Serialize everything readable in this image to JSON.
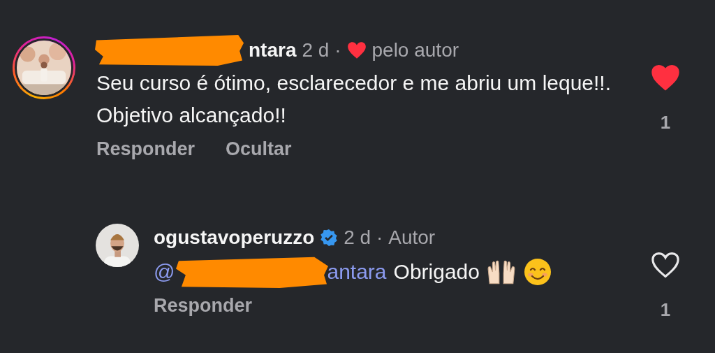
{
  "comments": [
    {
      "kind": "comment",
      "story_ring": true,
      "username": "ntara",
      "username_redacted": true,
      "verified": false,
      "meta": "2 d ·",
      "liked_by_author": true,
      "author_label": "pelo autor",
      "text": "Seu curso é ótimo, esclarecedor e me abriu um leque!!. Objetivo alcançado!!",
      "emojis": false,
      "actions": [
        "Responder",
        "Ocultar"
      ],
      "liked": true,
      "likes": "1"
    },
    {
      "kind": "reply",
      "story_ring": false,
      "username": "ogustavoperuzzo",
      "username_redacted": false,
      "verified": true,
      "meta": "2 d ·",
      "liked_by_author": false,
      "author_label": "Autor",
      "mention": "@",
      "mention_tail": "antara",
      "text": "Obrigado",
      "emojis": true,
      "actions": [
        "Responder"
      ],
      "liked": false,
      "likes": "1"
    }
  ]
}
